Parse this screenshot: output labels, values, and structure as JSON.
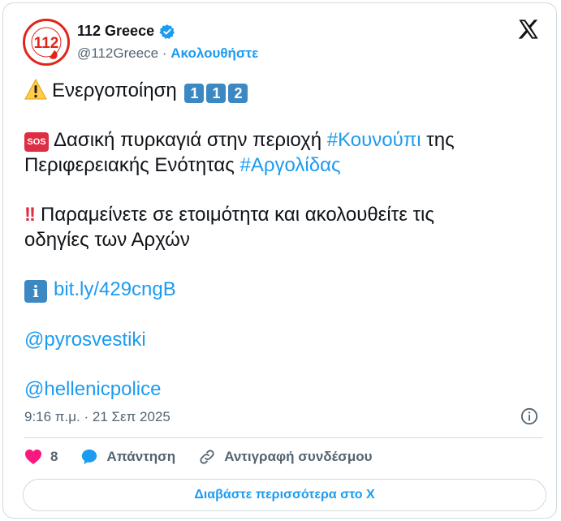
{
  "author": {
    "name": "112 Greece",
    "handle": "@112Greece",
    "separator": "·",
    "follow_label": "Ακολουθήστε",
    "avatar_text": "112",
    "avatar_ring_text": "ΕΥΡΩΠΑΪΚΟΣ ΑΡΙΘΜΟΣ ΕΚΤΑΚΤΟΥ ΑΝΑΓΚΗΣ"
  },
  "tweet": {
    "line1": {
      "text": "Ενεργοποίηση",
      "keycaps": [
        "1",
        "1",
        "2"
      ]
    },
    "line2": {
      "sos_label": "SOS",
      "prefix": "Δασική πυρκαγιά στην περιοχή ",
      "tag1": "#Κουνούπι",
      "mid": " της"
    },
    "line3": {
      "prefix": "Περιφερειακής Ενότητας ",
      "tag2": "#Αργολίδας"
    },
    "line4": {
      "bang": "!!",
      "text": "Παραμείνετε σε ετοιμότητα και ακολουθείτε τις"
    },
    "line5": "οδηγίες των Αρχών",
    "link": {
      "info_glyph": "i",
      "url": "bit.ly/429cngB"
    },
    "mention1": "@pyrosvestiki",
    "mention2": "@hellenicpolice"
  },
  "meta": {
    "timestamp": "9:16 π.μ. · 21 Σεπ 2025"
  },
  "actions": {
    "likes": "8",
    "reply_label": "Απάντηση",
    "copy_label": "Αντιγραφή συνδέσμου"
  },
  "read_more_label": "Διαβάστε περισσότερα στο X",
  "colors": {
    "accent": "#1d9bf0",
    "heart": "#f91880",
    "keycap": "#3b88c3",
    "sos": "#dd2e44"
  }
}
